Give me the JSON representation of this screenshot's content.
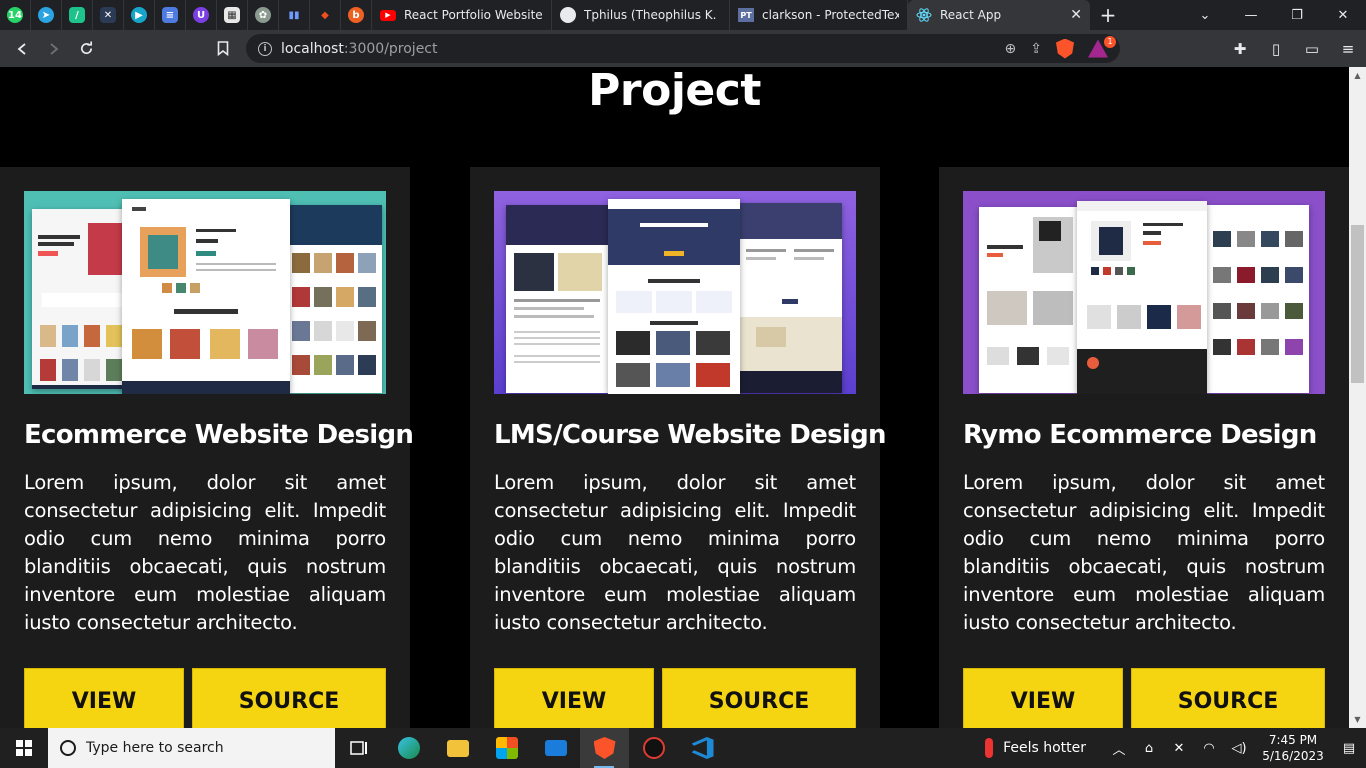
{
  "browser": {
    "pinned_tabs": [
      {
        "icon": "whatsapp-icon",
        "color": "#25d366",
        "glyph": "14"
      },
      {
        "icon": "telegram-icon",
        "color": "#2aa3e0",
        "glyph": "➤"
      },
      {
        "icon": "feather-icon",
        "color": "#1ec28b",
        "glyph": "/"
      },
      {
        "icon": "x-logo-icon",
        "color": "#3b5998",
        "glyph": "✕"
      },
      {
        "icon": "play-icon",
        "color": "#17a6c9",
        "glyph": "▶"
      },
      {
        "icon": "docs-icon",
        "color": "#4e7be0",
        "glyph": "≡"
      },
      {
        "icon": "shield-u-icon",
        "color": "#7b3fe4",
        "glyph": "U"
      },
      {
        "icon": "newspaper-icon",
        "color": "#e8e8e8",
        "glyph": "▦"
      },
      {
        "icon": "chatgpt-icon",
        "color": "#8a9a8e",
        "glyph": "✿"
      },
      {
        "icon": "analytics-icon",
        "color": "#3d6fd6",
        "glyph": "▮"
      },
      {
        "icon": "figma-icon",
        "color": "#f24e1e",
        "glyph": "◆"
      },
      {
        "icon": "bitly-icon",
        "color": "#ee6123",
        "glyph": "b"
      }
    ],
    "tabs": [
      {
        "title": "React Portfolio Website Tut",
        "icon": "youtube-icon",
        "active": false
      },
      {
        "title": "Tphilus (Theophilus K. Dadz",
        "icon": "github-icon",
        "active": false
      },
      {
        "title": "clarkson - ProtectedText",
        "icon": "protectedtext-icon",
        "active": false
      },
      {
        "title": "React App",
        "icon": "react-icon",
        "active": true
      }
    ],
    "new_tab_label": "+",
    "url_host": "localhost",
    "url_path": ":3000/project",
    "rewards_badge": "1"
  },
  "page": {
    "section_title": "Project",
    "projects": [
      {
        "title": "Ecommerce Website Design",
        "description": "Lorem ipsum, dolor sit amet consectetur adipisicing elit. Impedit odio cum nemo minima porro blanditiis obcaecati, quis nostrum inventore eum molestiae aliquam iusto consectetur architecto.",
        "view_label": "VIEW",
        "source_label": "SOURCE",
        "thumb_bg": "#4fbfb4"
      },
      {
        "title": "LMS/Course Website Design",
        "description": "Lorem ipsum, dolor sit amet consectetur adipisicing elit. Impedit odio cum nemo minima porro blanditiis obcaecati, quis nostrum inventore eum molestiae aliquam iusto consectetur architecto.",
        "view_label": "VIEW",
        "source_label": "SOURCE",
        "thumb_bg": "#7c55d8"
      },
      {
        "title": "Rymo Ecommerce Design",
        "description": "Lorem ipsum, dolor sit amet consectetur adipisicing elit. Impedit odio cum nemo minima porro blanditiis obcaecati, quis nostrum inventore eum molestiae aliquam iusto consectetur architecto.",
        "view_label": "VIEW",
        "source_label": "SOURCE",
        "thumb_bg": "#8a4fc9"
      }
    ]
  },
  "taskbar": {
    "search_placeholder": "Type here to search",
    "weather_text": "Feels hotter",
    "time": "7:45 PM",
    "date": "5/16/2023"
  },
  "colors": {
    "accent_button": "#f5d511",
    "card_bg": "#1c1c1c",
    "page_bg": "#000000"
  }
}
